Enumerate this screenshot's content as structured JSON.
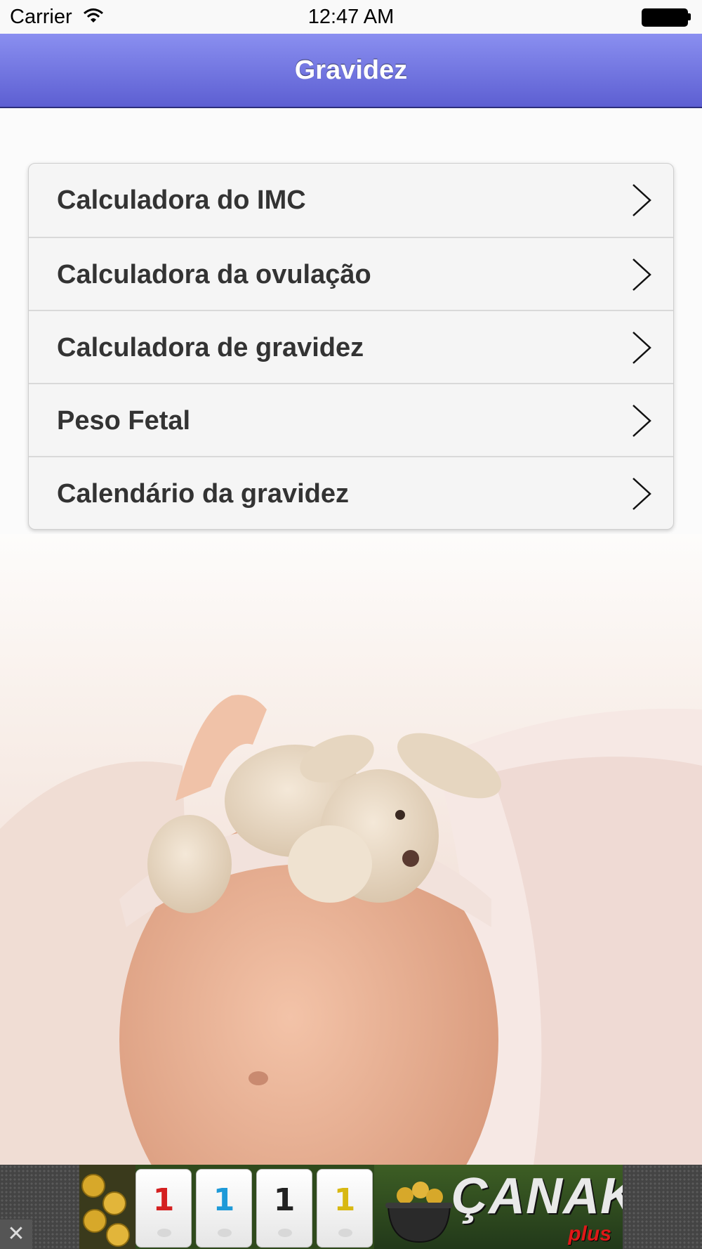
{
  "status_bar": {
    "carrier": "Carrier",
    "time": "12:47 AM"
  },
  "nav_bar": {
    "title": "Gravidez"
  },
  "menu": {
    "items": [
      {
        "label": "Calculadora do IMC",
        "icon": "chevron-right-icon"
      },
      {
        "label": "Calculadora da ovulação",
        "icon": "chevron-right-icon"
      },
      {
        "label": "Calculadora de gravidez",
        "icon": "chevron-right-icon"
      },
      {
        "label": "Peso Fetal",
        "icon": "chevron-right-icon"
      },
      {
        "label": "Calendário da gravidez",
        "icon": "chevron-right-icon"
      }
    ]
  },
  "ad": {
    "close_glyph": "✕",
    "tiles": [
      {
        "number": "1",
        "color": "#d42020"
      },
      {
        "number": "1",
        "color": "#1e9ad8"
      },
      {
        "number": "1",
        "color": "#222222"
      },
      {
        "number": "1",
        "color": "#d8b812"
      }
    ],
    "brand": "ÇANAK",
    "brand_sub": "plus"
  },
  "colors": {
    "nav_top": "#8a8ff0",
    "nav_bottom": "#5d5fd2",
    "menu_bg": "#f5f5f5",
    "label_text": "#333333"
  }
}
